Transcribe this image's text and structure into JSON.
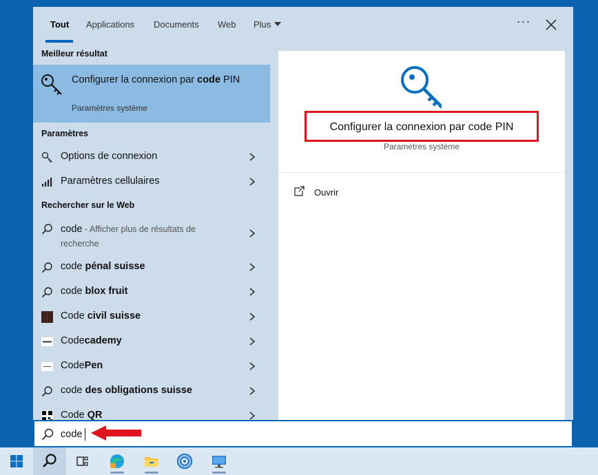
{
  "tabs": [
    {
      "label": "Tout",
      "active": true
    },
    {
      "label": "Applications"
    },
    {
      "label": "Documents"
    },
    {
      "label": "Web"
    },
    {
      "label": "Plus"
    }
  ],
  "more_label": "···",
  "best_match": {
    "header": "Meilleur résultat",
    "title_start": "Configurer la connexion par ",
    "title_bold": "code",
    "title_end": " PIN",
    "subtitle": "Paramètres système"
  },
  "settings": {
    "header": "Paramètres",
    "items": [
      {
        "label": "Options de connexion",
        "icon": "key-icon"
      },
      {
        "label": "Paramètres cellulaires",
        "icon": "cellular-icon"
      }
    ]
  },
  "web": {
    "header": "Rechercher sur le Web",
    "first_main": "code",
    "first_extra": " - Afficher plus de résultats de recherche",
    "items": [
      {
        "base": "code ",
        "bold": "pénal suisse",
        "icon": "search-icon"
      },
      {
        "base": "code ",
        "bold": "blox fruit",
        "icon": "search-icon"
      },
      {
        "base": "Code ",
        "bold": "civil suisse",
        "icon": "site-thumbnail-icon"
      },
      {
        "base": "Code",
        "bold": "cademy",
        "icon": "site-thumbnail-icon"
      },
      {
        "base": "Code",
        "bold": "Pen",
        "icon": "site-thumbnail-icon"
      },
      {
        "base": "code ",
        "bold": "des obligations suisse",
        "icon": "search-icon"
      },
      {
        "base": "Code ",
        "bold": "QR",
        "icon": "qr-icon"
      }
    ]
  },
  "detail": {
    "title": "Configurer la connexion par code PIN",
    "subtitle": "Paramètres système",
    "open_label": "Ouvrir"
  },
  "search": {
    "value": "code"
  },
  "colors": {
    "accent": "#0067c0",
    "highlight": "#e0141e",
    "panel": "#cddcea",
    "best_bg": "#8bbae2"
  }
}
